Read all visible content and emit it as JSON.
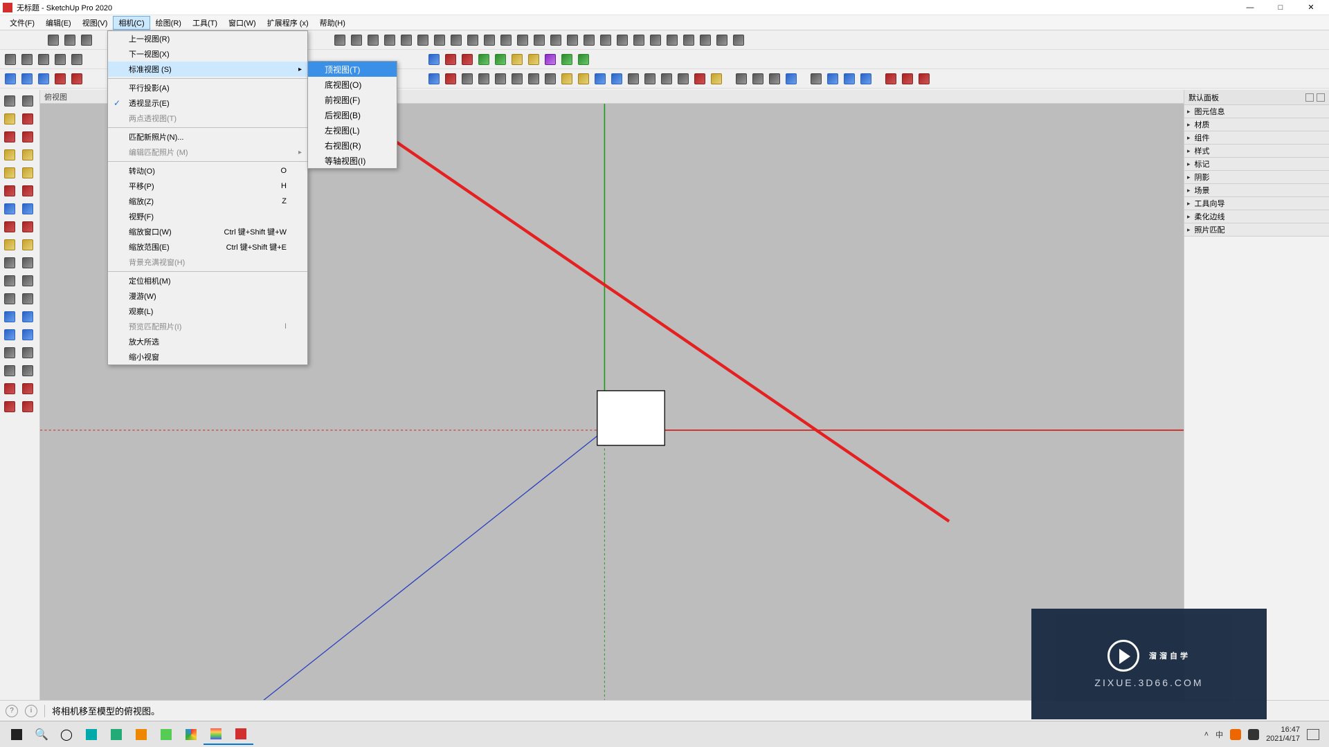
{
  "window": {
    "title": "无标题 - SketchUp Pro 2020",
    "minimize": "—",
    "maximize": "□",
    "close": "✕"
  },
  "menubar": [
    "文件(F)",
    "编辑(E)",
    "视图(V)",
    "相机(C)",
    "绘图(R)",
    "工具(T)",
    "窗口(W)",
    "扩展程序 (x)",
    "帮助(H)"
  ],
  "active_menu_index": 3,
  "dropdown": {
    "items": [
      {
        "label": "上一视图(R)"
      },
      {
        "label": "下一视图(X)"
      },
      {
        "label": "标准视图 (S)",
        "hassub": true,
        "highlight": true
      },
      {
        "sep": true
      },
      {
        "label": "平行投影(A)"
      },
      {
        "label": "透视显示(E)",
        "checked": true
      },
      {
        "label": "两点透视图(T)",
        "disabled": true
      },
      {
        "sep": true
      },
      {
        "label": "匹配新照片(N)..."
      },
      {
        "label": "编辑匹配照片 (M)",
        "disabled": true,
        "hassub": true
      },
      {
        "sep": true
      },
      {
        "label": "转动(O)",
        "shortcut": "O"
      },
      {
        "label": "平移(P)",
        "shortcut": "H"
      },
      {
        "label": "缩放(Z)",
        "shortcut": "Z"
      },
      {
        "label": "视野(F)"
      },
      {
        "label": "缩放窗口(W)",
        "shortcut": "Ctrl 键+Shift 键+W"
      },
      {
        "label": "缩放范围(E)",
        "shortcut": "Ctrl 键+Shift 键+E"
      },
      {
        "label": "背景充满视窗(H)",
        "disabled": true
      },
      {
        "sep": true
      },
      {
        "label": "定位相机(M)"
      },
      {
        "label": "漫游(W)"
      },
      {
        "label": "观察(L)"
      },
      {
        "label": "预览匹配照片(I)",
        "shortcut": "I",
        "disabled": true
      },
      {
        "label": "放大所选"
      },
      {
        "label": "缩小视窗"
      }
    ]
  },
  "submenu": {
    "items": [
      {
        "label": "顶视图(T)",
        "highlight": true
      },
      {
        "label": "底视图(O)"
      },
      {
        "label": "前视图(F)"
      },
      {
        "label": "后视图(B)"
      },
      {
        "label": "左视图(L)"
      },
      {
        "label": "右视图(R)"
      },
      {
        "label": "等轴视图(I)"
      }
    ]
  },
  "viewport": {
    "title": "俯视图"
  },
  "rightpanel": {
    "title": "默认面板",
    "sections": [
      "图元信息",
      "材质",
      "组件",
      "样式",
      "标记",
      "阴影",
      "场景",
      "工具向导",
      "柔化边线",
      "照片匹配"
    ]
  },
  "status": {
    "text": "将相机移至模型的俯视图。"
  },
  "taskbar": {
    "clock_time": "16:47",
    "clock_date": "2021/4/17"
  },
  "watermark": {
    "title": "溜溜自学",
    "url": "ZIXUE.3D66.COM"
  }
}
